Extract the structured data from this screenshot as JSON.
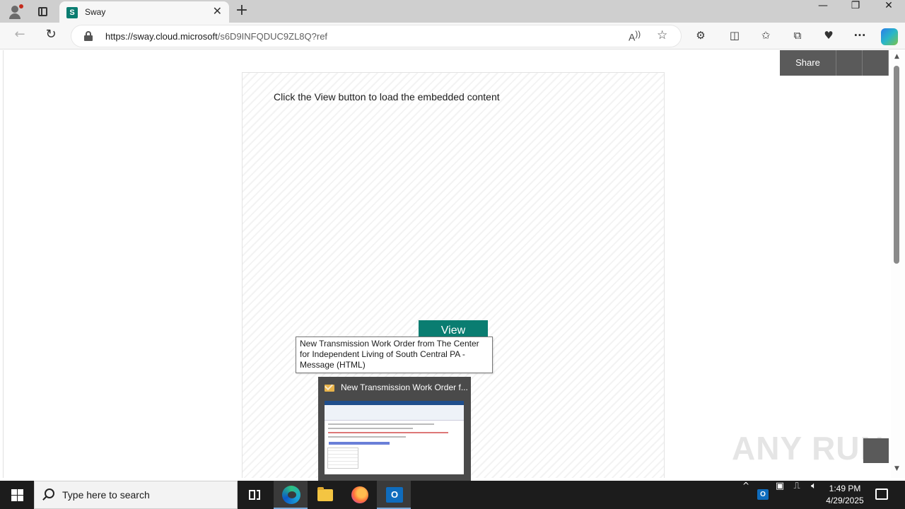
{
  "browser": {
    "tab_title": "Sway",
    "favicon_letter": "S",
    "tab_close": "✕",
    "new_tab": "+",
    "url_host": "https://sway.cloud.microsoft",
    "url_path": "/s6D9INFQDUC9ZL8Q?ref",
    "window_controls": {
      "minimize": "—",
      "restore": "❐",
      "close": "✕"
    },
    "icons": [
      "profile-icon",
      "tab-actions-icon",
      "back-icon",
      "refresh-icon",
      "lock-icon",
      "read-aloud-icon",
      "favorite-star-icon",
      "extensions-icon",
      "split-screen-icon",
      "favorites-icon",
      "collections-icon",
      "performance-icon",
      "more-menu-icon",
      "copilot-icon"
    ]
  },
  "page": {
    "embed_hint": "Click the View button to load the embedded content",
    "view_button": "View",
    "share_button": "Share",
    "accent_color": "#0a7d71",
    "watermark": "ANY RUN"
  },
  "tooltip": {
    "text": "New Transmission Work Order from The Center for Independent Living of South Central PA - Message (HTML)"
  },
  "taskbar_preview": {
    "title": "New Transmission Work Order f..."
  },
  "taskbar": {
    "search_placeholder": "Type here to search",
    "apps": [
      "task-view",
      "edge",
      "file-explorer",
      "firefox",
      "outlook"
    ],
    "time": "1:49 PM",
    "date": "4/29/2025"
  }
}
